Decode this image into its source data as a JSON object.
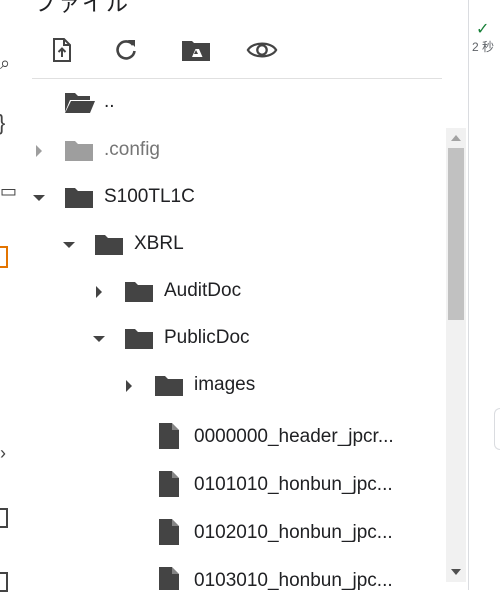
{
  "header": {
    "title": "ファイル"
  },
  "toolbar": {
    "upload": "upload-file-icon",
    "refresh": "refresh-icon",
    "drive": "drive-mount-icon",
    "visibility": "visibility-icon"
  },
  "tree": [
    {
      "label": "..",
      "kind": "folder-open"
    },
    {
      "label": ".config",
      "kind": "folder",
      "expanded": false,
      "dim": true
    },
    {
      "label": "S100TL1C",
      "kind": "folder",
      "expanded": true
    },
    {
      "label": "XBRL",
      "kind": "folder",
      "expanded": true
    },
    {
      "label": "AuditDoc",
      "kind": "folder",
      "expanded": false
    },
    {
      "label": "PublicDoc",
      "kind": "folder",
      "expanded": true
    },
    {
      "label": "images",
      "kind": "folder",
      "expanded": false
    },
    {
      "label": "0000000_header_jpcr...",
      "kind": "file"
    },
    {
      "label": "0101010_honbun_jpc...",
      "kind": "file"
    },
    {
      "label": "0102010_honbun_jpc...",
      "kind": "file"
    },
    {
      "label": "0103010_honbun_jpc...",
      "kind": "file"
    }
  ],
  "status": {
    "check": "✓",
    "duration": "2 秒"
  },
  "colors": {
    "folder": "#444444",
    "folder_dim": "#9e9e9e",
    "check": "#188038"
  }
}
